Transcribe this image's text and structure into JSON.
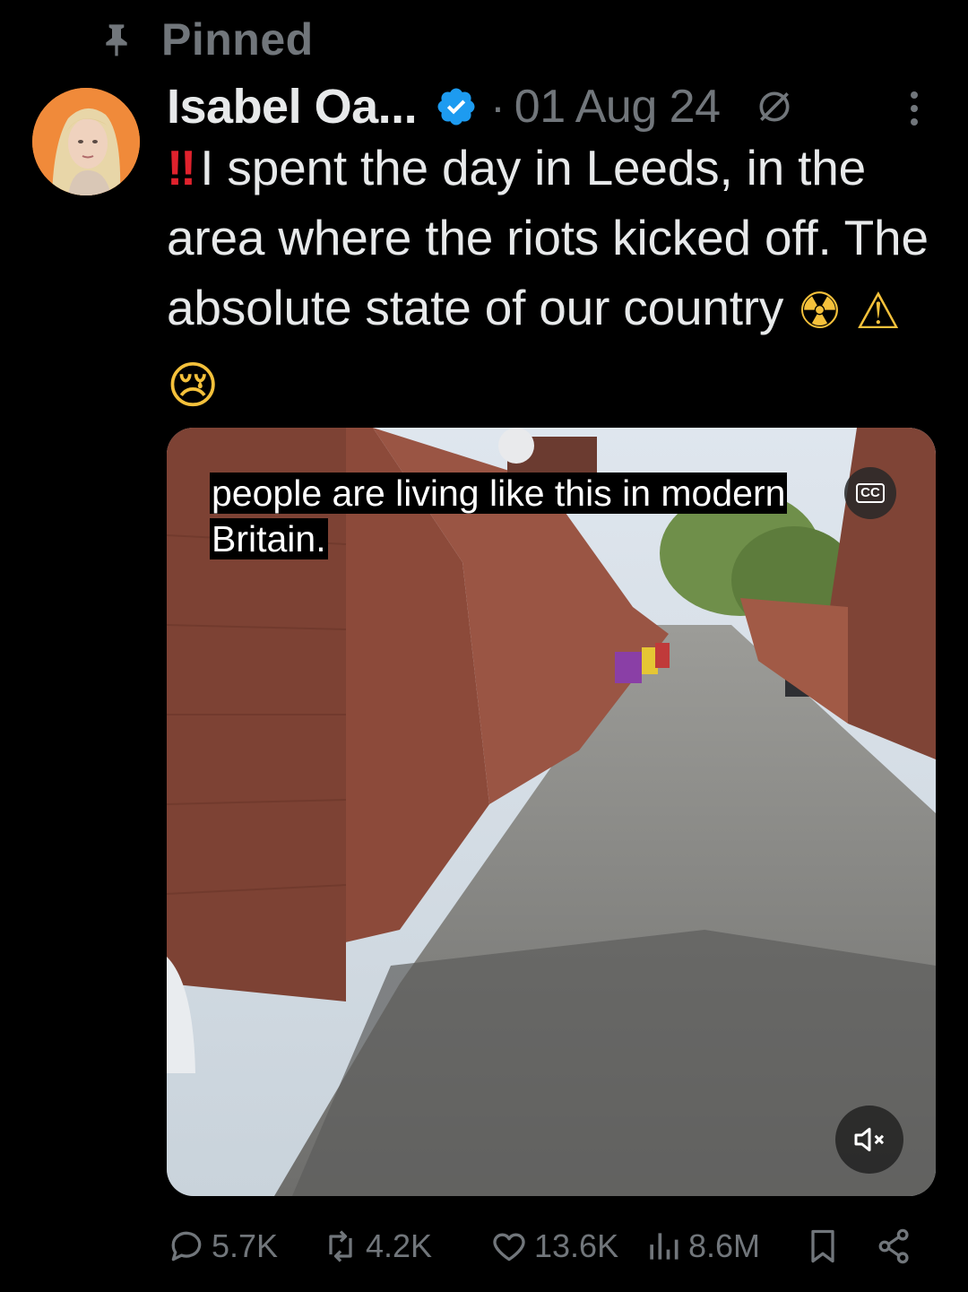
{
  "pinned": {
    "label": "Pinned",
    "icon": "pin-icon"
  },
  "author": {
    "display_name": "Isabel Oa...",
    "verified": true,
    "avatar_icon": "avatar",
    "badge_color": "#1d9bf0"
  },
  "post": {
    "separator": "·",
    "date": "01 Aug 24",
    "edited_icon": "edited-icon",
    "bang": "‼",
    "text": "I spent the day in Leeds, in the area where the riots kicked off. The absolute state of our country",
    "emojis": [
      "☢",
      "⚠",
      "😢"
    ]
  },
  "media": {
    "caption": "people are living like this in modern Britain.",
    "cc_label": "CC",
    "muted": true
  },
  "actions": {
    "replies": "5.7K",
    "reposts": "4.2K",
    "likes": "13.6K",
    "views": "8.6M"
  },
  "colors": {
    "background": "#000000",
    "text": "#e7e9ea",
    "muted_text": "#71767b",
    "accent": "#1d9bf0",
    "alert_red": "#e0222d"
  }
}
